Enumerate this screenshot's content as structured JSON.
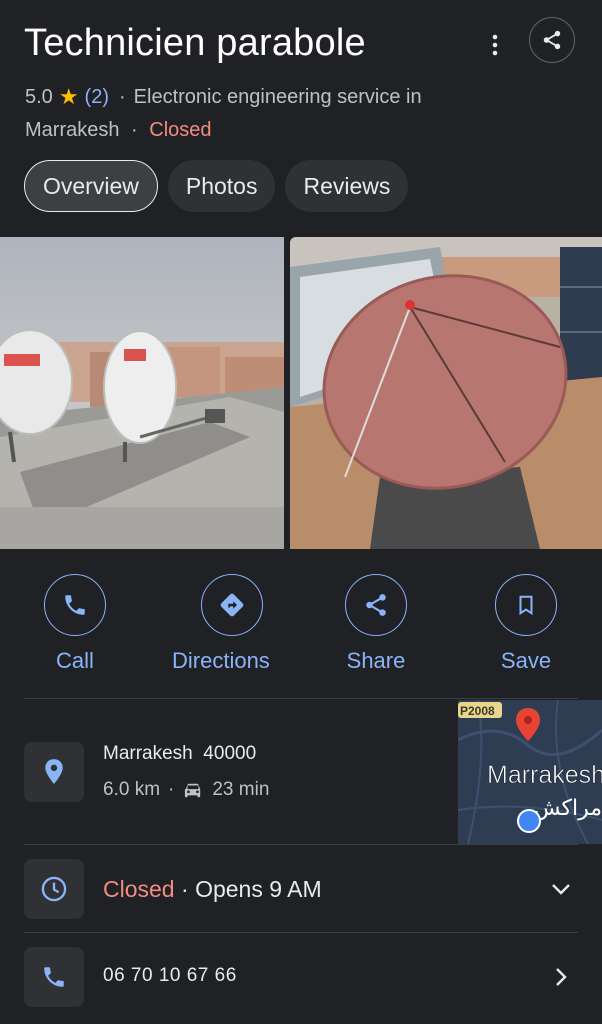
{
  "place": {
    "title": "Technicien parabole",
    "rating": "5.0",
    "review_count": "(2)",
    "separator": "·",
    "category": "Electronic engineering service in",
    "city": "Marrakesh",
    "status": "Closed"
  },
  "tabs": [
    {
      "label": "Overview"
    },
    {
      "label": "Photos"
    },
    {
      "label": "Reviews"
    }
  ],
  "actions": {
    "call": "Call",
    "directions": "Directions",
    "share": "Share",
    "save": "Save"
  },
  "address": {
    "line": "Marrakesh  40000",
    "distance": "6.0 km",
    "separator": "·",
    "drive_time": "23 min"
  },
  "map": {
    "road_label": "P2008",
    "city_label": "Marrakesh",
    "city_label_ar": "مراكش"
  },
  "hours": {
    "status": "Closed",
    "separator": " · ",
    "opens": "Opens 9 AM"
  },
  "phone": {
    "number": "06 70 10 67 66"
  },
  "colors": {
    "background": "#202124",
    "accent": "#8ab4f8",
    "closed": "#f28b82",
    "star": "#fbbc04"
  },
  "icons": {
    "more": "more-vert-icon",
    "share": "share-icon",
    "call": "phone-icon",
    "directions": "directions-icon",
    "save": "bookmark-icon",
    "location": "location-pin-icon",
    "car": "car-icon",
    "clock": "clock-icon",
    "expand": "chevron-down-icon",
    "open": "chevron-right-icon"
  }
}
